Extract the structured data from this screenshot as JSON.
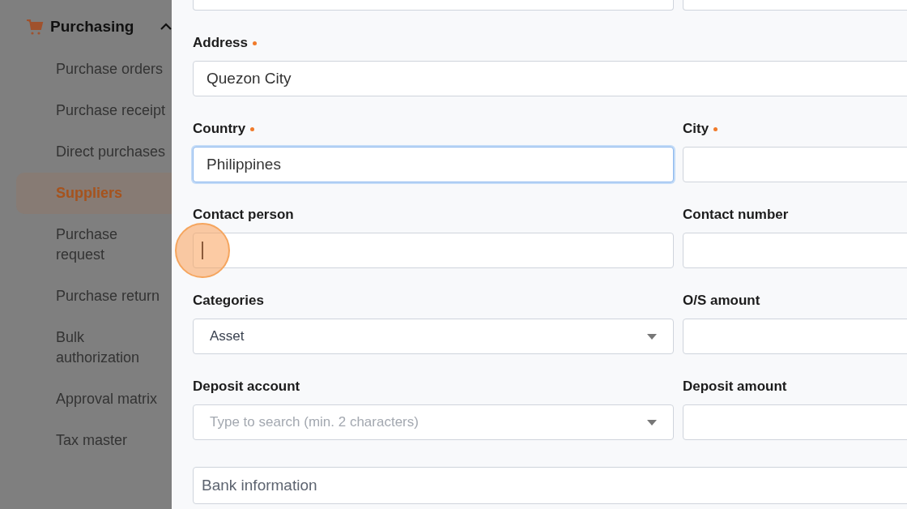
{
  "sidebar": {
    "section": {
      "label": "Purchasing",
      "expanded": true
    },
    "items": [
      {
        "label": "Purchase orders",
        "selected": false
      },
      {
        "label": "Purchase receipt",
        "selected": false
      },
      {
        "label": "Direct purchases",
        "selected": false
      },
      {
        "label": "Suppliers",
        "selected": true
      },
      {
        "label": "Purchase request",
        "selected": false
      },
      {
        "label": "Purchase return",
        "selected": false
      },
      {
        "label": "Bulk authorization",
        "selected": false
      },
      {
        "label": "Approval matrix",
        "selected": false
      },
      {
        "label": "Tax master",
        "selected": false
      }
    ]
  },
  "form": {
    "rows": [
      {
        "fields": [
          {
            "kind": "text",
            "focused": false
          },
          {
            "kind": "text",
            "focused": false
          }
        ]
      },
      {
        "fields": [
          {
            "kind": "text",
            "label": "Address",
            "required": true,
            "value": "Quezon City",
            "wide": true,
            "focused": false
          }
        ]
      },
      {
        "fields": [
          {
            "kind": "text",
            "label": "Country",
            "required": true,
            "value": "Philippines",
            "focused": true
          },
          {
            "kind": "text",
            "label": "City",
            "required": true,
            "focused": false
          }
        ]
      },
      {
        "fields": [
          {
            "kind": "text",
            "label": "Contact person",
            "focused": false,
            "clicked": true
          },
          {
            "kind": "text",
            "label": "Contact number",
            "focused": false
          }
        ]
      },
      {
        "fields": [
          {
            "kind": "select",
            "label": "Categories",
            "value": "Asset",
            "focused": false
          },
          {
            "kind": "text",
            "label": "O/S amount",
            "focused": false
          }
        ]
      },
      {
        "fields": [
          {
            "kind": "select",
            "label": "Deposit account",
            "placeholder": "Type to search (min. 2 characters)",
            "focused": false
          },
          {
            "kind": "text",
            "label": "Deposit amount",
            "focused": false
          }
        ]
      }
    ],
    "section": {
      "label": "Bank information"
    }
  }
}
